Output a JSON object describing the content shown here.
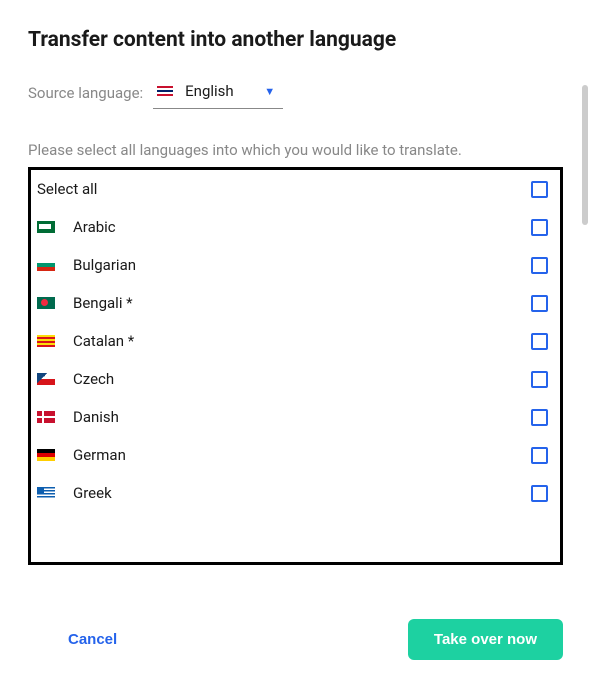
{
  "title": "Transfer content into another language",
  "source": {
    "label": "Source language:",
    "selected": "English"
  },
  "instruction": "Please select all languages into which you would like to translate.",
  "select_all_label": "Select all",
  "languages": [
    {
      "name": "Arabic",
      "flag": "sa"
    },
    {
      "name": "Bulgarian",
      "flag": "bg"
    },
    {
      "name": "Bengali *",
      "flag": "bd"
    },
    {
      "name": "Catalan *",
      "flag": "ct"
    },
    {
      "name": "Czech",
      "flag": "cz"
    },
    {
      "name": "Danish",
      "flag": "dk"
    },
    {
      "name": "German",
      "flag": "de"
    },
    {
      "name": "Greek",
      "flag": "gr"
    }
  ],
  "buttons": {
    "cancel": "Cancel",
    "takeover": "Take over now"
  }
}
